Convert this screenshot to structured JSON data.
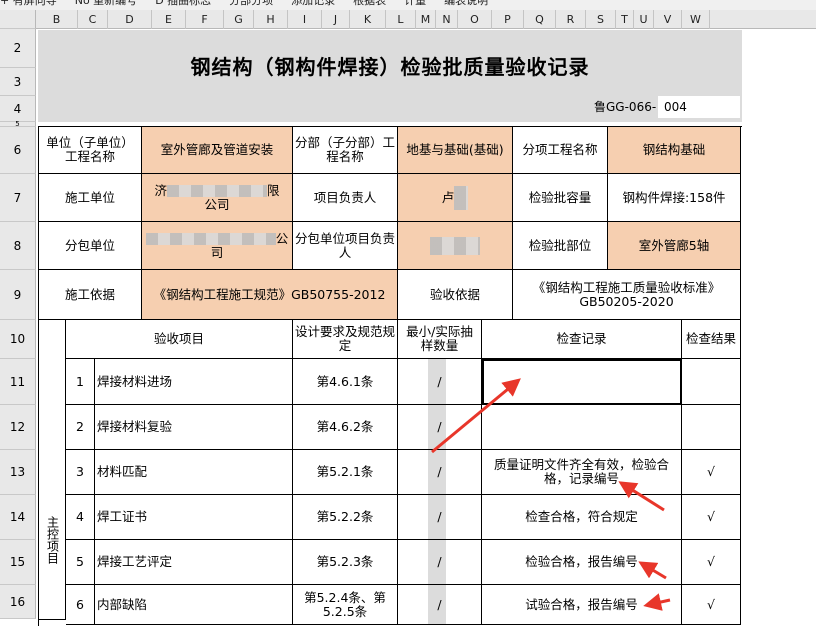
{
  "toolbar": {
    "items": [
      "+ 有屏向导",
      "No 重新编号",
      "D 插曲标志",
      "分部分项",
      "添加记录",
      "根据表",
      "计量",
      "编表说明"
    ]
  },
  "columns": [
    "B",
    "C",
    "D",
    "E",
    "F",
    "G",
    "H",
    "I",
    "J",
    "K",
    "L",
    "M",
    "N",
    "O",
    "P",
    "Q",
    "R",
    "S",
    "T",
    "U",
    "V",
    "W"
  ],
  "rows": [
    "2",
    "3",
    "4",
    "5",
    "6",
    "7",
    "8",
    "9",
    "10",
    "11",
    "12",
    "13",
    "14",
    "15",
    "16"
  ],
  "title": "钢结构（钢构件焊接）检验批质量验收记录",
  "code_label": "鲁GG-066-",
  "code_value": "004",
  "header": {
    "unit_label": "单位（子单位）工程名称",
    "unit_value": "室外管廊及管道安装",
    "part_label": "分部（子分部）工程名称",
    "part_value": "地基与基础(基础)",
    "sub_label": "分项工程名称",
    "sub_value": "钢结构基础",
    "builder_label": "施工单位",
    "builder_value_a": "济",
    "builder_value_b": "限",
    "builder_value_c": "公司",
    "pm_label": "项目负责人",
    "pm_value": "卢",
    "capacity_label": "检验批容量",
    "capacity_value": "钢构件焊接:158件",
    "subcon_label": "分包单位",
    "subcon_value_a": "公",
    "subcon_value_b": "司",
    "subpm_label": "分包单位项目负责人",
    "location_label": "检验批部位",
    "location_value": "室外管廊5轴",
    "basis_label": "施工依据",
    "basis_value": "《钢结构工程施工规范》GB50755-2012",
    "accept_label": "验收依据",
    "accept_value": "《钢结构工程施工质量验收标准》GB50205-2020"
  },
  "table": {
    "col_item": "验收项目",
    "col_req": "设计要求及规范规定",
    "col_sample": "最小/实际抽样数量",
    "col_record": "检查记录",
    "col_result": "检查结果",
    "group": "主控项目",
    "rows": [
      {
        "no": "1",
        "name": "焊接材料进场",
        "req": "第4.6.1条",
        "sample": "/",
        "record": "",
        "result": ""
      },
      {
        "no": "2",
        "name": "焊接材料复验",
        "req": "第4.6.2条",
        "sample": "/",
        "record": "",
        "result": ""
      },
      {
        "no": "3",
        "name": "材料匹配",
        "req": "第5.2.1条",
        "sample": "/",
        "record": "质量证明文件齐全有效，检验合格，记录编号",
        "result": "√"
      },
      {
        "no": "4",
        "name": "焊工证书",
        "req": "第5.2.2条",
        "sample": "/",
        "record": "检查合格，符合规定",
        "result": "√"
      },
      {
        "no": "5",
        "name": "焊接工艺评定",
        "req": "第5.2.3条",
        "sample": "/",
        "record": "检验合格，报告编号",
        "result": "√"
      },
      {
        "no": "6",
        "name": "内部缺陷",
        "req": "第5.2.4条、第5.2.5条",
        "sample": "/",
        "record": "试验合格，报告编号",
        "result": "√"
      }
    ]
  },
  "colors": {
    "peach": "#f6cfb0",
    "arrow": "#e8362a",
    "header": "#e8e8e8"
  }
}
